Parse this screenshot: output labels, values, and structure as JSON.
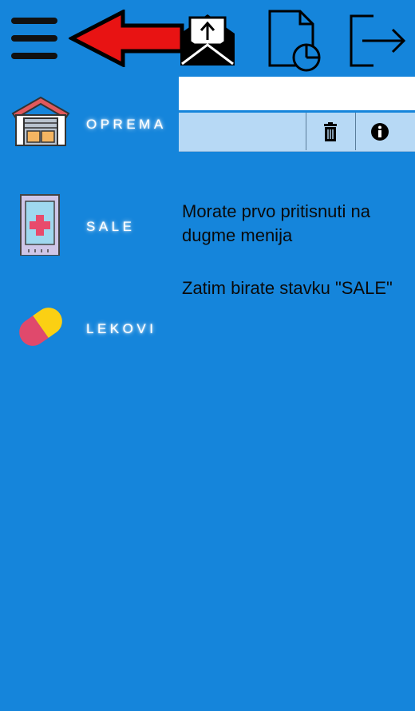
{
  "toolbar": {
    "menu_icon": "hamburger-menu-icon",
    "arrow_icon": "red-left-arrow",
    "upload_icon": "mail-upload-icon",
    "report_icon": "document-pie-chart-icon",
    "logout_icon": "logout-icon"
  },
  "table_toolbar": {
    "delete_icon": "trash-icon",
    "info_icon": "info-icon"
  },
  "sidebar": {
    "items": [
      {
        "label": "OPREMA",
        "icon": "warehouse-icon"
      },
      {
        "label": "SALE",
        "icon": "medical-door-icon"
      },
      {
        "label": "LEKOVI",
        "icon": "pill-capsule-icon"
      }
    ]
  },
  "instructions": {
    "line1": "Morate prvo pritisnuti na dugme menija",
    "line2": "Zatim birate stavku \"SALE\""
  },
  "colors": {
    "background": "#1585db",
    "arrow": "#e81313",
    "header_bar": "#b7d9f5"
  }
}
